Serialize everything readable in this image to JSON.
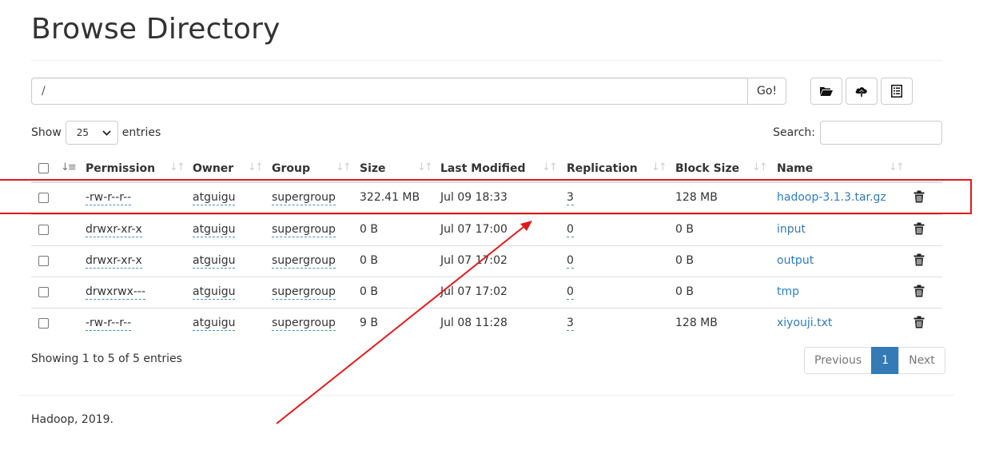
{
  "page": {
    "title": "Browse Directory",
    "footer": "Hadoop, 2019."
  },
  "toolbar": {
    "path_value": "/",
    "go_label": "Go!",
    "icons": [
      "folder-open-icon",
      "cloud-upload-icon",
      "list-icon"
    ]
  },
  "controls": {
    "show_label": "Show",
    "entries_value": "25",
    "entries_label": "entries",
    "search_label": "Search:",
    "search_value": ""
  },
  "table": {
    "columns": [
      "Permission",
      "Owner",
      "Group",
      "Size",
      "Last Modified",
      "Replication",
      "Block Size",
      "Name"
    ],
    "rows": [
      {
        "permission": "-rw-r--r--",
        "owner": "atguigu",
        "group": "supergroup",
        "size": "322.41 MB",
        "modified": "Jul 09 18:33",
        "replication": "3",
        "block_size": "128 MB",
        "name": "hadoop-3.1.3.tar.gz"
      },
      {
        "permission": "drwxr-xr-x",
        "owner": "atguigu",
        "group": "supergroup",
        "size": "0 B",
        "modified": "Jul 07 17:00",
        "replication": "0",
        "block_size": "0 B",
        "name": "input"
      },
      {
        "permission": "drwxr-xr-x",
        "owner": "atguigu",
        "group": "supergroup",
        "size": "0 B",
        "modified": "Jul 07 17:02",
        "replication": "0",
        "block_size": "0 B",
        "name": "output"
      },
      {
        "permission": "drwxrwx---",
        "owner": "atguigu",
        "group": "supergroup",
        "size": "0 B",
        "modified": "Jul 07 17:02",
        "replication": "0",
        "block_size": "0 B",
        "name": "tmp"
      },
      {
        "permission": "-rw-r--r--",
        "owner": "atguigu",
        "group": "supergroup",
        "size": "9 B",
        "modified": "Jul 08 11:28",
        "replication": "3",
        "block_size": "128 MB",
        "name": "xiyouji.txt"
      }
    ]
  },
  "pagination": {
    "info": "Showing 1 to 5 of 5 entries",
    "previous": "Previous",
    "current": "1",
    "next": "Next"
  },
  "colors": {
    "link": "#337ab7",
    "annotation": "#e0191c",
    "pager_active": "#337ab7"
  }
}
